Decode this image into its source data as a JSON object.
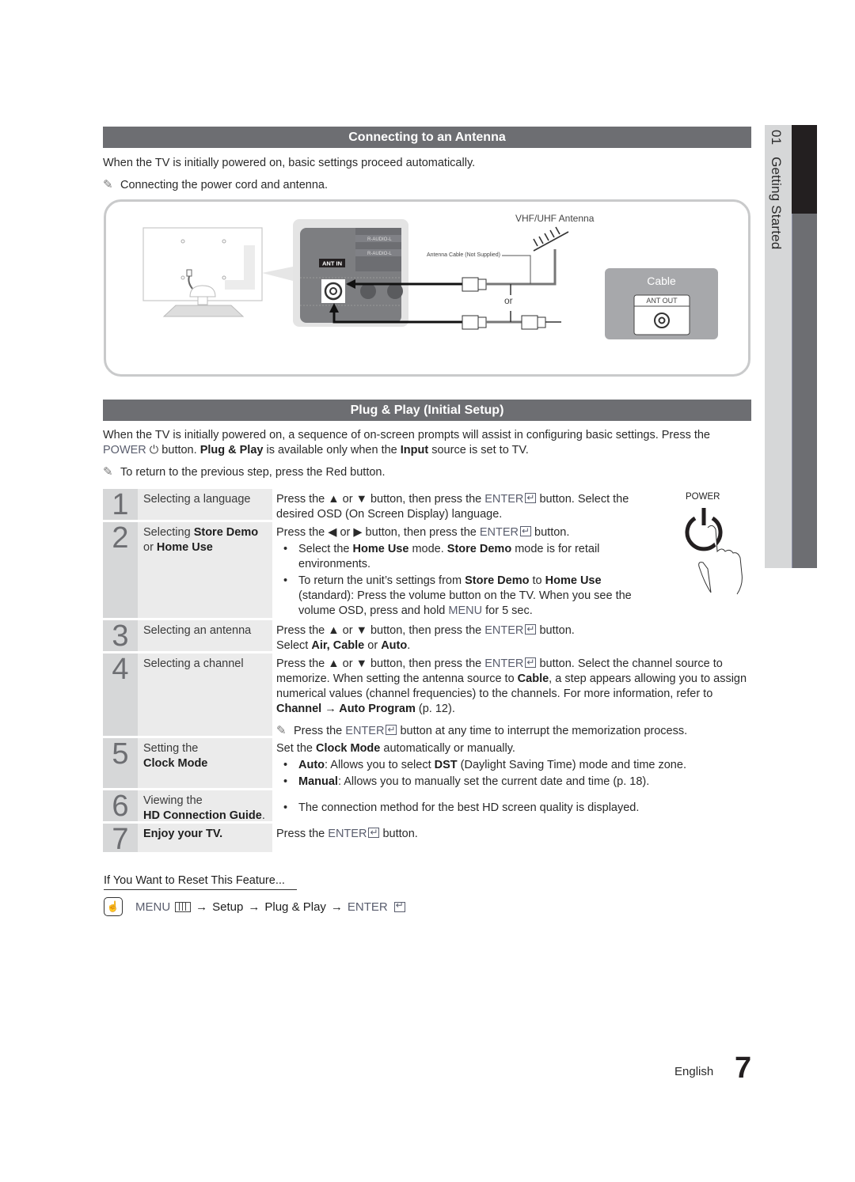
{
  "side_tab": {
    "chapter": "01",
    "title": "Getting Started"
  },
  "antenna_section": {
    "title": "Connecting to an Antenna",
    "intro": "When the TV is initially powered on, basic settings proceed automatically.",
    "note": "Connecting the power cord and antenna.",
    "diagram": {
      "ant_in_label": "ANT IN",
      "audio_label_1": "R-AUDIO-L",
      "audio_label_2": "R-AUDIO-L",
      "antenna_label": "VHF/UHF Antenna",
      "cable_note": "Antenna Cable (Not Supplied)",
      "or_label": "or",
      "cable_box_title": "Cable",
      "ant_out_label": "ANT OUT"
    }
  },
  "plug_play_section": {
    "title": "Plug & Play (Initial Setup)",
    "intro_1": "When the TV is initially powered on, a sequence of on-screen prompts will assist in configuring basic settings. Press the",
    "intro_power": "POWER",
    "intro_2": " button. ",
    "intro_pp": "Plug & Play",
    "intro_3": " is available only when the ",
    "intro_input": "Input",
    "intro_4": " source is set to TV.",
    "note": "To return to the previous step, press the Red button.",
    "power_graphic_label": "POWER",
    "steps": [
      {
        "num": "1",
        "label": "Selecting a language",
        "desc_1": "Press the ▲ or ▼ button, then press the ",
        "enter": "ENTER",
        "desc_2": " button. Select the desired OSD (On Screen Display) language."
      },
      {
        "num": "2",
        "label_1": "Selecting ",
        "label_b1": "Store Demo",
        "label_2": "or ",
        "label_b2": "Home Use",
        "desc_1": "Press the ◀ or ▶ button, then press the ",
        "enter": "ENTER",
        "desc_2": " button.",
        "bullet_1": {
          "t1": "Select the ",
          "b1": "Home Use",
          "t2": " mode. ",
          "b2": "Store Demo",
          "t3": " mode is for retail environments."
        },
        "bullet_2": {
          "t1": "To return the unit’s settings from ",
          "b1": "Store Demo",
          "t2": " to ",
          "b2": "Home Use",
          "t3": " (standard): Press the volume button on the TV. When you see the volume OSD, press and hold ",
          "menu": "MENU",
          "t4": " for 5 sec."
        }
      },
      {
        "num": "3",
        "label": "Selecting an antenna",
        "desc_1": "Press the ▲ or ▼ button, then press the ",
        "enter": "ENTER",
        "desc_2": " button.",
        "line2_1": "Select ",
        "line2_b1": "Air, Cable",
        "line2_2": " or ",
        "line2_b2": "Auto",
        "line2_3": "."
      },
      {
        "num": "4",
        "label": "Selecting a channel",
        "desc_1": "Press the ▲ or ▼ button, then press the ",
        "enter": "ENTER",
        "desc_2": " button. Select the channel source to memorize. When setting the antenna source to ",
        "desc_b1": "Cable",
        "desc_3": ", a step appears allowing you to assign numerical values (channel frequencies) to the channels. For more information, refer to ",
        "desc_b2": "Channel → Auto Program",
        "desc_4": " (p. 12).",
        "note_1": "Press the ",
        "note_enter": "ENTER",
        "note_2": " button at any time to interrupt the memorization process."
      },
      {
        "num": "5",
        "label_1": "Setting the",
        "label_b": "Clock Mode",
        "desc_1": "Set the ",
        "desc_b": "Clock Mode",
        "desc_2": " automatically or manually.",
        "bullet_1": {
          "b1": "Auto",
          "t1": ": Allows you to select ",
          "b2": "DST",
          "t2": " (Daylight Saving Time) mode and time zone."
        },
        "bullet_2": {
          "b1": "Manual",
          "t1": ": Allows you to manually set the current date and time (p. 18)."
        }
      },
      {
        "num": "6",
        "label_1": "Viewing the",
        "label_b": "HD Connection Guide",
        "label_2": ".",
        "bullet_1": "The connection method for the best HD screen quality is displayed."
      },
      {
        "num": "7",
        "label_b": "Enjoy your TV.",
        "desc_1": "Press the ",
        "enter": "ENTER",
        "desc_2": " button."
      }
    ],
    "reset": {
      "title": "If You Want to Reset This Feature...",
      "menu": "MENU",
      "arrow": "→",
      "setup": "Setup",
      "plug_play": "Plug & Play",
      "enter": "ENTER"
    }
  },
  "footer": {
    "language": "English",
    "page_number": "7"
  }
}
